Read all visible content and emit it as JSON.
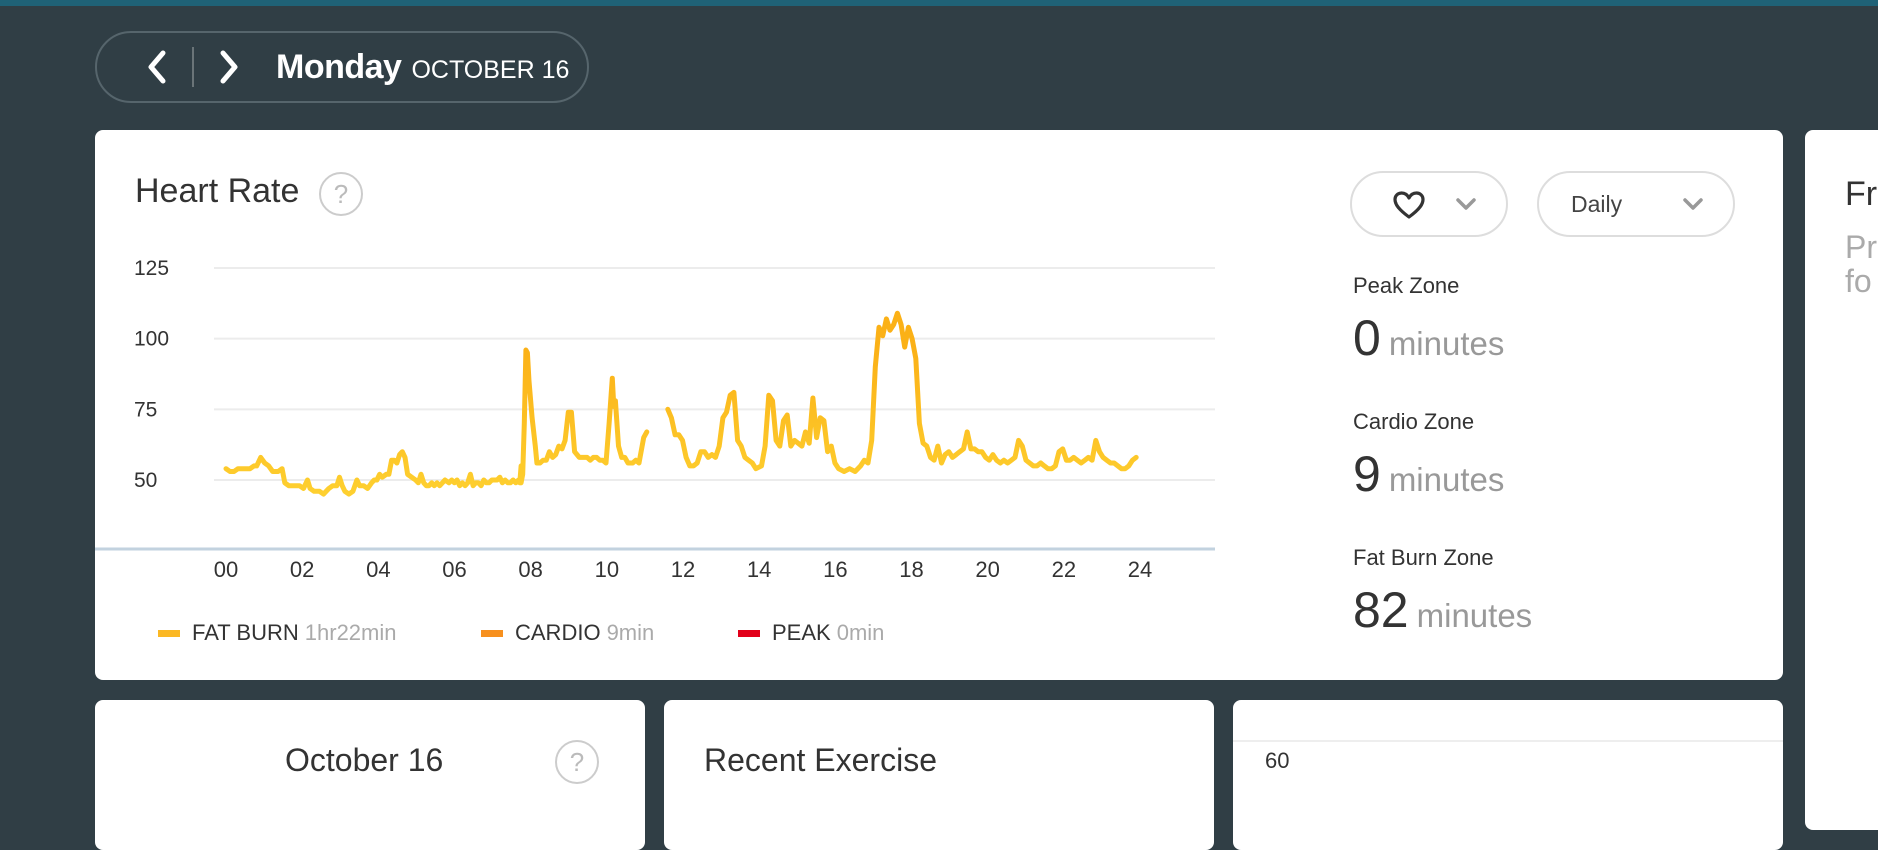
{
  "header": {
    "prev_label": "previous day",
    "next_label": "next day",
    "day": "Monday",
    "date": "OCTOBER 16"
  },
  "heart_rate_card": {
    "title": "Heart Rate",
    "help": "?",
    "metric_dropdown": {
      "icon": "heart-icon",
      "selected": "heart"
    },
    "period_dropdown": {
      "selected": "Daily"
    },
    "zones": [
      {
        "label": "Peak Zone",
        "value": "0",
        "unit": "minutes"
      },
      {
        "label": "Cardio Zone",
        "value": "9",
        "unit": "minutes"
      },
      {
        "label": "Fat Burn Zone",
        "value": "82",
        "unit": "minutes"
      }
    ],
    "legend": [
      {
        "name": "FAT BURN",
        "value": "1hr22min",
        "color": "#fbb824"
      },
      {
        "name": "CARDIO",
        "value": "9min",
        "color": "#f7901e"
      },
      {
        "name": "PEAK",
        "value": "0min",
        "color": "#e2001a"
      }
    ]
  },
  "friends_card": {
    "title": "Friends",
    "text_line1": "Pr",
    "text_line2": "fo"
  },
  "bottom_cards": {
    "sleep": {
      "title": "October 16",
      "help": "?"
    },
    "exercise": {
      "title": "Recent Exercise"
    },
    "third": {
      "tick": "60"
    }
  },
  "colors": {
    "background": "#303e45",
    "top_bar": "#1f6277",
    "line_low": "#ffe03d",
    "line_high": "#fbb117",
    "axis": "#c2d2df"
  },
  "chart_data": {
    "type": "line",
    "title": "Heart Rate",
    "xlabel": "",
    "ylabel": "",
    "xlim": [
      0,
      24
    ],
    "ylim": [
      40,
      125
    ],
    "yticks": [
      125,
      100,
      75,
      50
    ],
    "xticks": [
      "00",
      "02",
      "04",
      "06",
      "08",
      "10",
      "12",
      "14",
      "16",
      "18",
      "20",
      "22",
      "24"
    ],
    "grid": true,
    "legend_position": "bottom",
    "series": [
      {
        "name": "heart rate",
        "segments": [
          [
            [
              0.0,
              54
            ],
            [
              0.15,
              54
            ],
            [
              0.3,
              53
            ],
            [
              0.45,
              54
            ],
            [
              0.6,
              55
            ],
            [
              0.8,
              55
            ],
            [
              1.0,
              56
            ],
            [
              1.1,
              55
            ],
            [
              1.25,
              58
            ],
            [
              1.35,
              56
            ],
            [
              1.5,
              55
            ],
            [
              1.6,
              54
            ],
            [
              1.75,
              53
            ],
            [
              1.9,
              53
            ],
            [
              2.05,
              54
            ],
            [
              2.15,
              49
            ],
            [
              2.3,
              48
            ],
            [
              2.5,
              48
            ],
            [
              2.7,
              48
            ],
            [
              2.85,
              47
            ],
            [
              3.0,
              50
            ],
            [
              3.1,
              47
            ],
            [
              3.2,
              46
            ],
            [
              3.4,
              46
            ],
            [
              3.55,
              45
            ],
            [
              3.75,
              47
            ],
            [
              3.9,
              48
            ],
            [
              4.05,
              48
            ],
            [
              4.15,
              51
            ],
            [
              4.25,
              48
            ],
            [
              4.4,
              46
            ],
            [
              4.55,
              45
            ],
            [
              4.7,
              46
            ],
            [
              4.85,
              50
            ],
            [
              4.95,
              48
            ],
            [
              5.05,
              48
            ],
            [
              5.15,
              47
            ],
            [
              5.25,
              49
            ],
            [
              5.4,
              48
            ],
            [
              5.55,
              50
            ],
            [
              5.65,
              50
            ],
            [
              5.75,
              52
            ],
            [
              5.85,
              51
            ],
            [
              6.0,
              50
            ],
            [
              6.1,
              51
            ],
            [
              6.25,
              53
            ],
            [
              6.35,
              57
            ],
            [
              6.5,
              58
            ],
            [
              6.6,
              56
            ],
            [
              6.75,
              58
            ],
            [
              6.85,
              61
            ],
            [
              6.95,
              59
            ],
            [
              7.05,
              51
            ],
            [
              7.2,
              50
            ],
            [
              7.35,
              50
            ],
            [
              7.45,
              48
            ],
            [
              7.55,
              52
            ],
            [
              7.65,
              48
            ],
            [
              7.8,
              49
            ],
            [
              7.9,
              48
            ],
            [
              8.05,
              49
            ],
            [
              8.2,
              50
            ],
            [
              8.3,
              49
            ],
            [
              8.45,
              50
            ],
            [
              8.6,
              51
            ],
            [
              8.7,
              50
            ],
            [
              8.85,
              50
            ],
            [
              8.95,
              49
            ],
            [
              9.05,
              50
            ],
            [
              9.15,
              53
            ],
            [
              9.25,
              50
            ],
            [
              9.4,
              48
            ],
            [
              9.55,
              49
            ],
            [
              9.7,
              48
            ],
            [
              9.8,
              49
            ],
            [
              9.95,
              50
            ],
            [
              10.1,
              49
            ],
            [
              10.2,
              50
            ],
            [
              10.3,
              51
            ],
            [
              10.4,
              49
            ],
            [
              10.55,
              49
            ],
            [
              10.7,
              51
            ],
            [
              10.8,
              50
            ],
            [
              10.95,
              52
            ],
            [
              11.05,
              50
            ],
            [
              11.2,
              50
            ],
            [
              11.3,
              51
            ]
          ]
        ]
      }
    ],
    "detailed_series": [
      [
        0.0,
        54
      ],
      [
        0.2,
        53
      ],
      [
        0.45,
        54
      ],
      [
        0.7,
        55
      ],
      [
        1.0,
        55
      ],
      [
        1.15,
        56
      ],
      [
        1.3,
        58
      ],
      [
        1.5,
        55
      ],
      [
        1.7,
        53
      ],
      [
        1.95,
        53
      ],
      [
        2.1,
        54
      ],
      [
        2.25,
        49
      ],
      [
        2.6,
        48
      ],
      [
        2.85,
        48
      ],
      [
        3.0,
        47
      ],
      [
        3.15,
        50
      ],
      [
        3.3,
        46
      ],
      [
        3.6,
        46
      ],
      [
        3.8,
        45
      ],
      [
        4.05,
        47
      ],
      [
        4.3,
        48
      ],
      [
        4.45,
        48
      ],
      [
        4.6,
        51
      ],
      [
        4.8,
        46
      ],
      [
        5.0,
        46
      ],
      [
        5.25,
        45
      ],
      [
        5.4,
        46
      ],
      [
        5.55,
        50
      ],
      [
        5.75,
        48
      ],
      [
        5.9,
        47
      ],
      [
        6.05,
        49
      ],
      [
        6.2,
        48
      ],
      [
        6.4,
        50
      ],
      [
        6.6,
        51
      ],
      [
        6.75,
        49
      ],
      [
        6.95,
        50
      ],
      [
        7.15,
        53
      ],
      [
        7.3,
        57
      ],
      [
        7.45,
        56
      ],
      [
        7.6,
        58
      ],
      [
        7.75,
        60
      ],
      [
        7.9,
        58
      ],
      [
        8.05,
        52
      ],
      [
        8.3,
        52
      ],
      [
        8.45,
        49
      ],
      [
        8.6,
        51
      ],
      [
        8.75,
        48
      ],
      [
        8.9,
        50
      ],
      [
        9.05,
        49
      ],
      [
        9.25,
        49
      ],
      [
        9.45,
        51
      ],
      [
        9.6,
        52
      ],
      [
        9.75,
        51
      ],
      [
        9.9,
        50
      ],
      [
        10.05,
        49
      ],
      [
        10.25,
        50
      ],
      [
        10.45,
        48
      ],
      [
        10.6,
        50
      ],
      [
        10.75,
        48
      ],
      [
        10.95,
        49
      ],
      [
        11.15,
        51
      ],
      [
        11.3,
        50
      ],
      [
        11.45,
        52
      ],
      [
        11.6,
        50
      ],
      [
        11.75,
        49
      ],
      [
        11.85,
        49
      ],
      [
        11.95,
        50
      ],
      [
        12.05,
        52
      ],
      [
        12.15,
        49
      ],
      [
        12.25,
        50
      ],
      [
        12.4,
        49
      ],
      [
        12.55,
        50
      ],
      [
        12.65,
        52
      ],
      [
        12.8,
        50
      ],
      [
        12.95,
        50
      ],
      [
        13.1,
        51
      ],
      [
        13.3,
        50
      ],
      [
        13.45,
        49
      ],
      [
        13.6,
        52
      ],
      [
        13.75,
        50
      ],
      [
        13.9,
        50
      ],
      [
        14.05,
        49
      ],
      [
        14.2,
        52
      ],
      [
        14.35,
        50
      ],
      [
        14.55,
        50
      ],
      [
        14.75,
        49
      ],
      [
        14.95,
        49
      ],
      [
        15.1,
        51
      ],
      [
        15.25,
        50
      ],
      [
        15.4,
        52
      ],
      [
        15.6,
        51
      ],
      [
        15.75,
        49
      ],
      [
        15.9,
        49
      ],
      [
        16.05,
        50
      ]
    ]
  }
}
